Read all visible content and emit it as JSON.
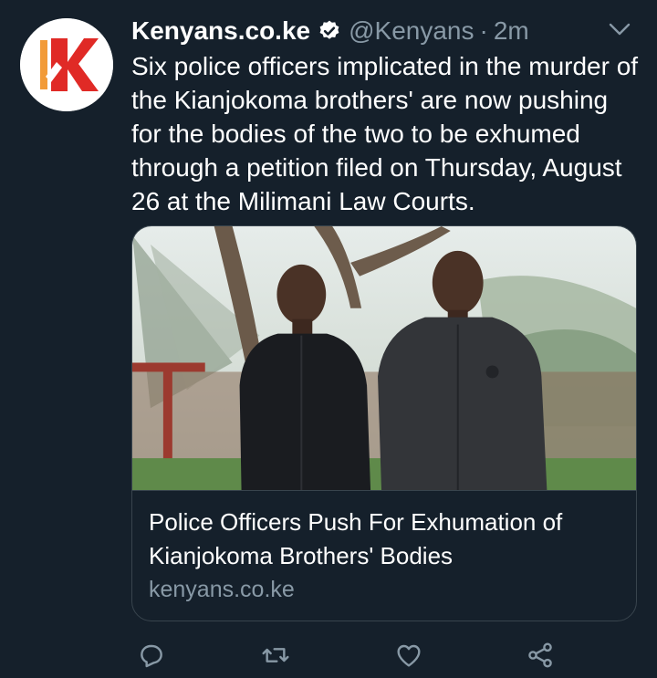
{
  "tweet": {
    "author_name": "Kenyans.co.ke",
    "author_handle": "@Kenyans",
    "separator": "·",
    "time": "2m",
    "avatar_icon": "kenyans-k-logo",
    "verified_icon": "verified-badge-icon",
    "menu_icon": "chevron-down-icon",
    "text": "Six police officers implicated in the murder of the Kianjokoma brothers' are now pushing for the bodies of the two to be exhumed through a petition filed on Thursday, August 26 at the Milimani Law Courts."
  },
  "card": {
    "title": "Police Officers Push For Exhumation of Kianjokoma Brothers' Bodies",
    "domain": "kenyans.co.ke"
  },
  "actions": [
    {
      "icon": "reply-icon"
    },
    {
      "icon": "retweet-icon"
    },
    {
      "icon": "like-icon"
    },
    {
      "icon": "share-icon"
    }
  ],
  "colors": {
    "background": "#15202b",
    "border": "#38444d",
    "secondary_text": "#8899a6",
    "primary_text": "#ffffff",
    "logo_red": "#e02a26"
  }
}
